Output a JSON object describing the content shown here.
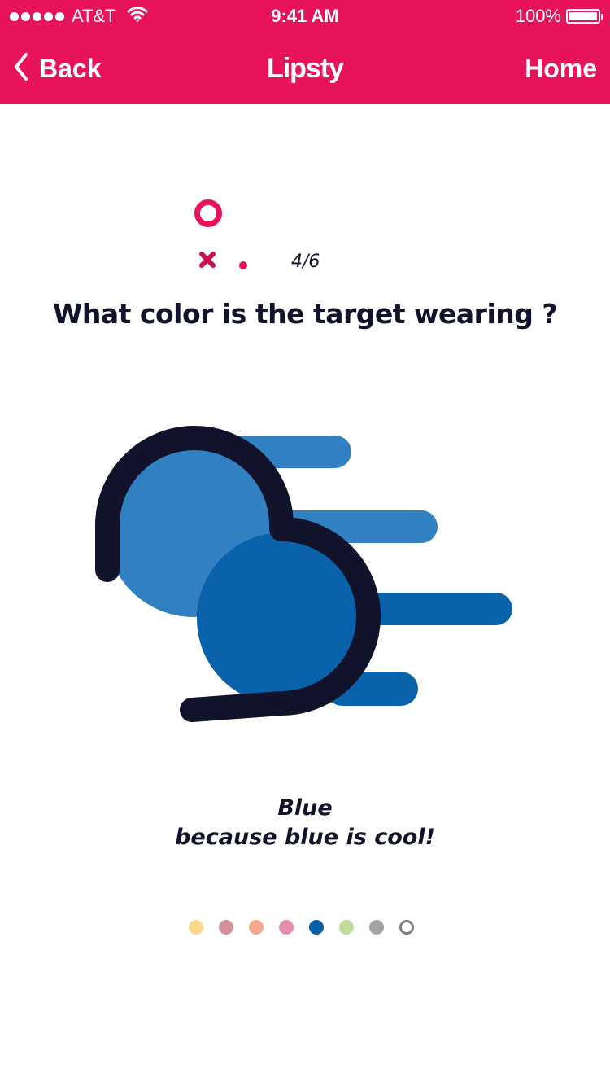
{
  "status_bar": {
    "carrier": "AT&T",
    "time": "9:41 AM",
    "battery": "100%"
  },
  "nav": {
    "back_label": "Back",
    "title": "Lipsty",
    "home_label": "Home"
  },
  "progress": {
    "count": "4/6"
  },
  "question": "What color is the target wearing ?",
  "answer": {
    "color": "Blue",
    "reason": "because blue is cool!"
  },
  "colors": {
    "accent": "#e8145a",
    "dark": "#11132a",
    "blue_light": "#3180c2",
    "blue_dark": "#0a62ab"
  },
  "swatches": [
    {
      "color": "#fcd88a",
      "selected": false,
      "style": "filled"
    },
    {
      "color": "#d39198",
      "selected": false,
      "style": "filled"
    },
    {
      "color": "#f3aa8c",
      "selected": false,
      "style": "filled"
    },
    {
      "color": "#e58fa8",
      "selected": false,
      "style": "filled"
    },
    {
      "color": "#0b5fa5",
      "selected": true,
      "style": "filled"
    },
    {
      "color": "#bfdc9b",
      "selected": false,
      "style": "filled"
    },
    {
      "color": "#a3a3a3",
      "selected": false,
      "style": "filled"
    },
    {
      "color": "#7d7d7d",
      "selected": false,
      "style": "outline"
    }
  ]
}
